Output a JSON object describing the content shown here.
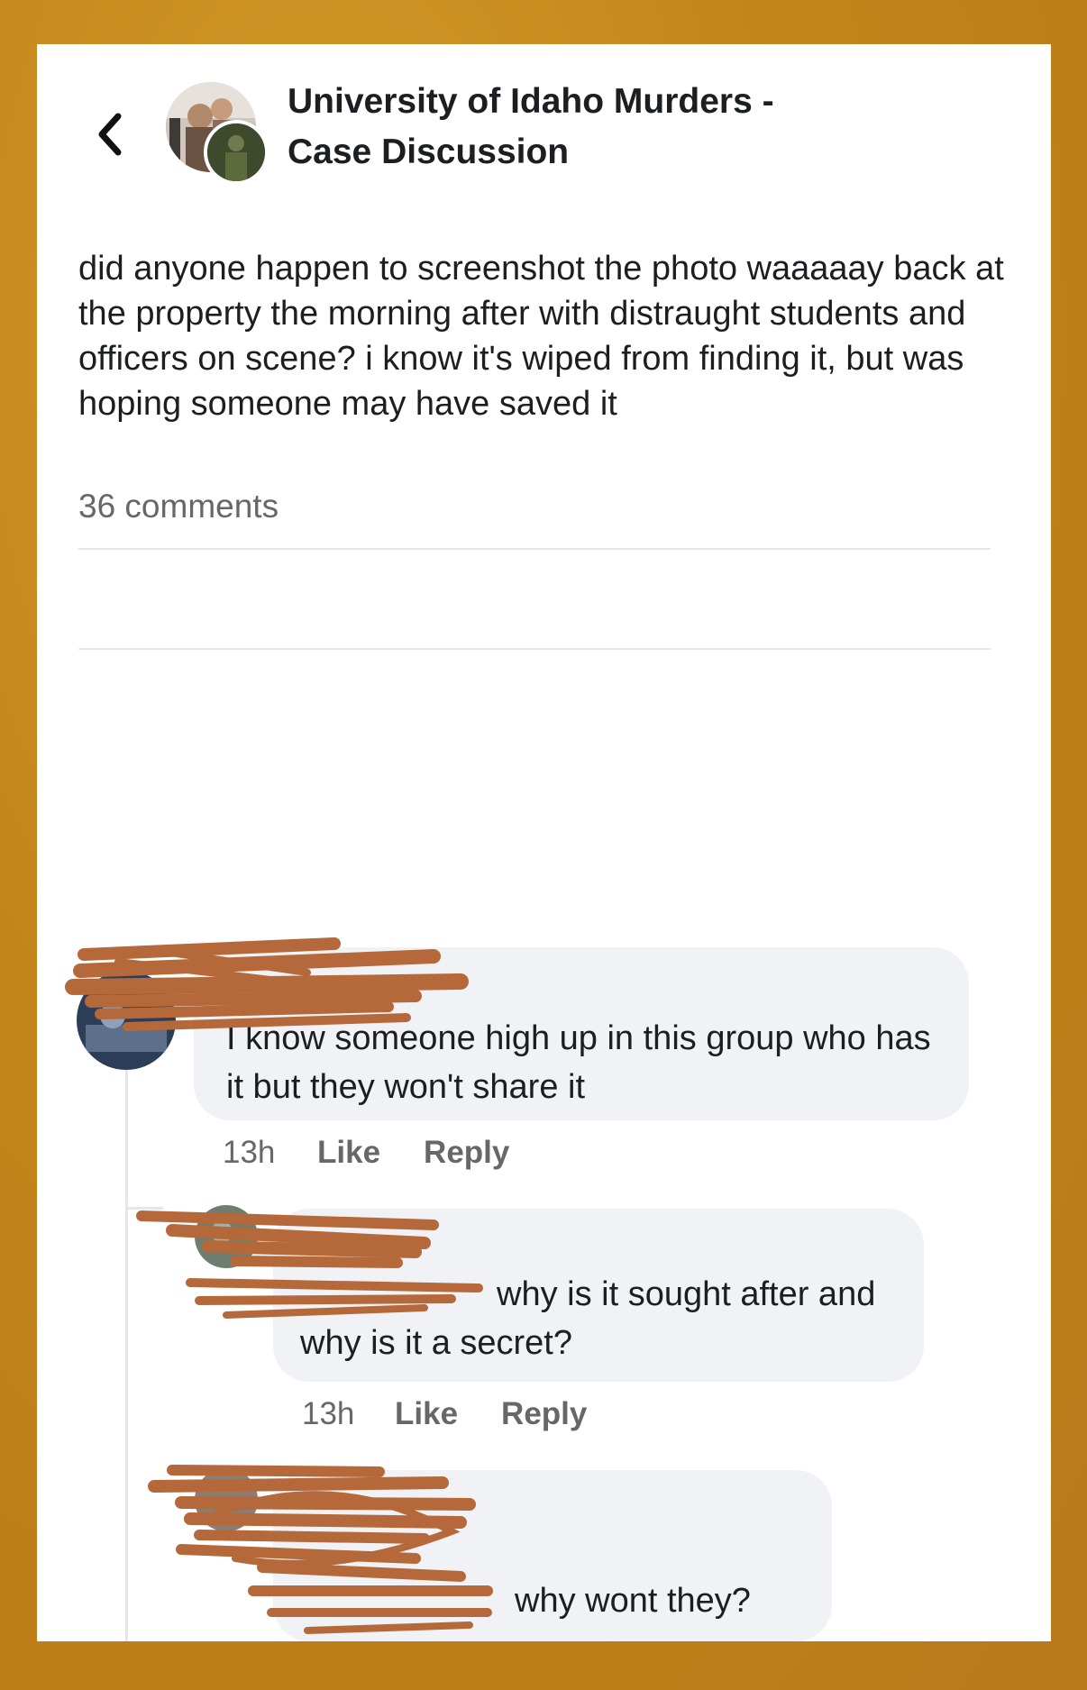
{
  "header": {
    "group_title_line1": "University of Idaho Murders -",
    "group_title_line2": "Case Discussion",
    "back_icon": "chevron-left-icon"
  },
  "post": {
    "text": "did anyone happen to screenshot the photo waaaaay back at the property the morning after with distraught students and officers on scene? i know it's wiped from finding it, but was hoping someone may have saved it",
    "comments_count": "36 comments"
  },
  "comments": [
    {
      "author": "",
      "text": "I know someone high up in this group who has it but they won't share it",
      "time": "13h",
      "like_label": "Like",
      "reply_label": "Reply"
    },
    {
      "author": "",
      "text": "why is it sought after and why is it a secret?",
      "time": "13h",
      "like_label": "Like",
      "reply_label": "Reply"
    },
    {
      "author": "",
      "text": "why wont they?"
    }
  ],
  "colors": {
    "frame_background": "#c98a1e",
    "redaction": "#b5683a",
    "bubble": "#f0f2f5",
    "text": "#1c1e21",
    "muted": "#65676b"
  }
}
